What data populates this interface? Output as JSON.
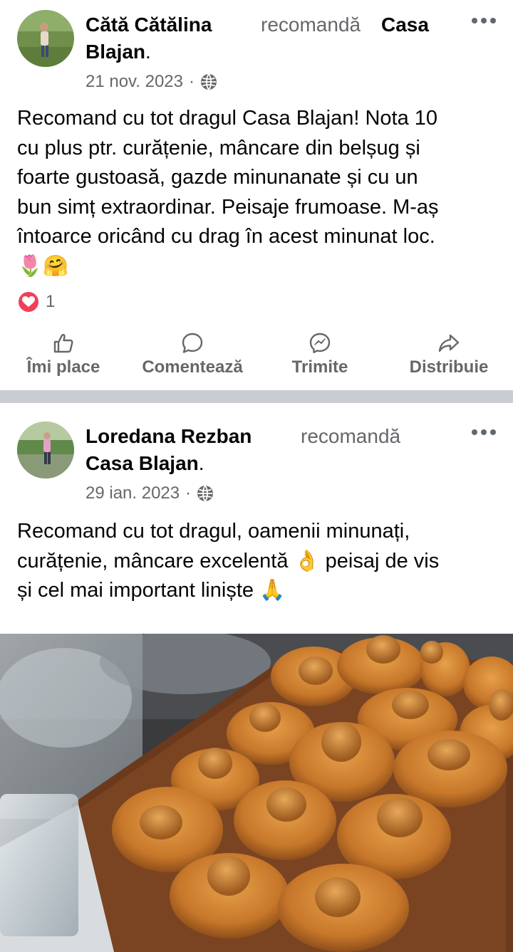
{
  "posts": [
    {
      "author_line1": "Cătă Cătălina",
      "author_line2": "Blajan",
      "recommends": "recomandă",
      "page_name": "Casa",
      "period": ".",
      "date": "21 nov. 2023",
      "separator": "·",
      "text_lines": [
        "Recomand cu tot dragul Casa Blajan! Nota 10",
        "cu plus ptr. curățenie, mâncare din belșug și",
        "foarte gustoasă, gazde minunanate și cu un",
        "bun simț extraordinar. Peisaje frumoase. M-aș",
        "întoarce oricând cu drag în acest minunat loc."
      ],
      "emojis": "🌷🤗",
      "reaction_count": "1"
    },
    {
      "author": "Loredana Rezban",
      "recommends": "recomandă",
      "page_name": "Casa Blajan",
      "period": ".",
      "date": "29 ian. 2023",
      "separator": "·",
      "text_lines": [
        "Recomand cu tot dragul, oamenii minunați,",
        "curățenie, mâncare excelentă 👌 peisaj de vis",
        "și cel mai important liniște 🙏"
      ]
    }
  ],
  "actions": {
    "like": "Îmi place",
    "comment": "Comentează",
    "send": "Trimite",
    "share": "Distribuie"
  },
  "icons": {
    "globe": "globe-icon",
    "more": "more-options-icon",
    "like": "thumbs-up-icon",
    "comment": "comment-bubble-icon",
    "send": "messenger-icon",
    "share": "share-arrow-icon",
    "heart": "heart-reaction-icon"
  },
  "colors": {
    "text": "#050505",
    "secondary": "#65676b",
    "separator": "#c9ccd1",
    "heart": "#f33e58"
  }
}
